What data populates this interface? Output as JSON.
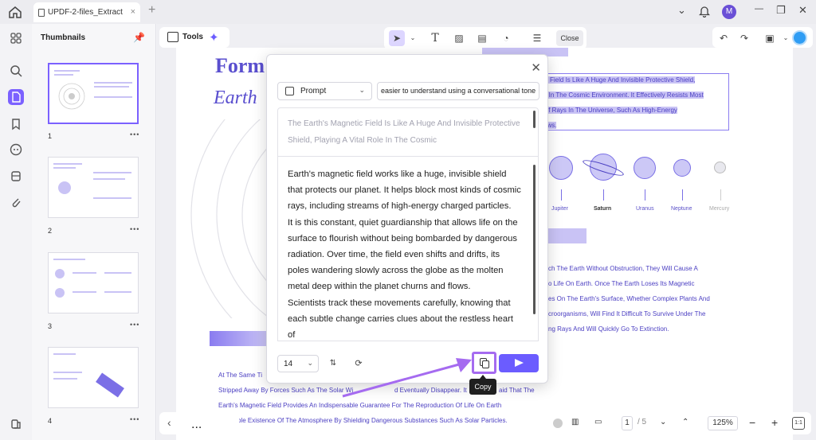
{
  "tab": {
    "title": "UPDF-2-files_Extract",
    "close": "×",
    "add": "+"
  },
  "window": {
    "avatar": "M",
    "minimize": "—",
    "restore": "❐",
    "close": "✕",
    "chevron": "⌄",
    "bell": "🔔"
  },
  "sidebar": {
    "title": "Thumbnails",
    "pages": [
      "1",
      "2",
      "3",
      "4"
    ],
    "more": "•••"
  },
  "tools": {
    "label": "Tools"
  },
  "toolbar": {
    "close_label": "Close"
  },
  "document": {
    "title_line1": "Form",
    "title_line2": "Earth",
    "selected_lines": [
      "ic Field Is Like A Huge And Invisible Protective Shield,",
      "g In The Cosmic Environment. It Effectively Resists Most",
      "Of Rays In The Universe, Such As High-Energy",
      "ows."
    ],
    "planets": [
      "Jupiter",
      "Saturn",
      "Uranus",
      "Neptune",
      "Mercury"
    ],
    "right_lines": [
      "ch The Earth Without Obstruction, They Will Cause A",
      "o Life On Earth. Once The Earth Loses Its Magnetic",
      "es On The Earth's Surface, Whether Complex Plants And",
      "croorganisms, Will Find It Difficult To Survive Under The",
      "ng Rays And Will Quickly Go To Extinction."
    ],
    "bottom_lines": [
      "At The Same Ti",
      "Stripped Away By Forces Such As The Solar Wi",
      "Earth's Magnetic Field Provides An Indispensable Guarantee For The Reproduction Of Life On Earth",
      "Stable Existence Of The Atmosphere By Shielding Dangerous Substances Such As Solar Particles."
    ],
    "bottom_right_fragment": "d Eventually Disappear. It",
    "bottom_right_fragment2": "aid That The"
  },
  "ai_modal": {
    "prompt_label": "Prompt",
    "prompt_input": "easier to understand using a conversational tone",
    "source_text": "The Earth's Magnetic Field Is Like A Huge And Invisible Protective Shield, Playing A Vital Role In The Cosmic",
    "result_text": "Earth's magnetic field works like a huge, invisible shield that protects our planet. It helps block most kinds of cosmic rays, including streams of high-energy charged particles.\nIt is this constant, quiet guardianship that allows life on the surface to flourish without being bombarded by dangerous radiation. Over time, the field even shifts and drifts, its poles wandering slowly across the globe as the molten metal deep within the planet churns and flows.\nScientists track these movements carefully, knowing that each subtle change carries clues about the restless heart of",
    "font_size": "14",
    "copy_tooltip": "Copy"
  },
  "pager": {
    "current": "1",
    "total": "/ 5",
    "zoom": "125%",
    "nav_more": "...",
    "prev": "‹"
  },
  "colors": {
    "accent": "#6b5cff",
    "highlight": "#c9c3f5",
    "doc_text": "#4b3fc2",
    "arrow": "#a56bf0"
  }
}
